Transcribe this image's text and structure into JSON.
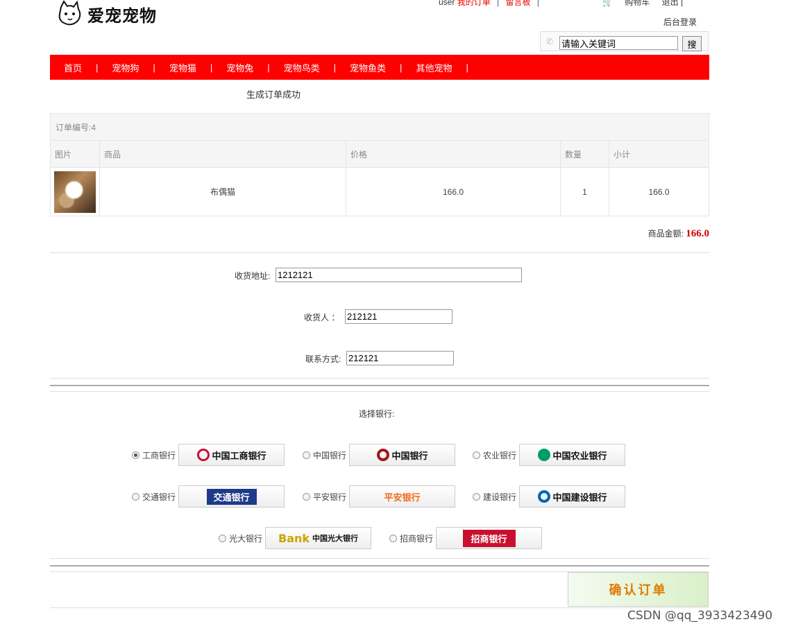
{
  "header": {
    "logo_text": "爱宠宠物",
    "user": "user",
    "my_orders": "我的订单",
    "message_board": "留言板",
    "cart": "购物车",
    "logout": "退出",
    "admin_login": "后台登录",
    "search_placeholder": "请输入关键词",
    "search_value": "请输入关键词",
    "search_button": "搜"
  },
  "nav": {
    "items": [
      "首页",
      "宠物狗",
      "宠物猫",
      "宠物兔",
      "宠物鸟类",
      "宠物鱼类",
      "其他宠物"
    ]
  },
  "order": {
    "success_msg": "生成订单成功",
    "order_no": "订单编号:4",
    "columns": [
      "图片",
      "商品",
      "价格",
      "数量",
      "小计"
    ],
    "rows": [
      {
        "image": "cat-photo",
        "name": "布偶猫",
        "price": "166.0",
        "qty": "1",
        "subtotal": "166.0"
      }
    ],
    "amount_label": "商品金额:",
    "amount_value": "166.0"
  },
  "form": {
    "address_label": "收货地址:",
    "address_value": "1212121",
    "receiver_label": "收货人 ：",
    "receiver_value": "212121",
    "contact_label": "联系方式:",
    "contact_value": "212121"
  },
  "bank": {
    "title": "选择银行:",
    "options": [
      {
        "name": "工商银行",
        "logo": "中国工商银行",
        "checked": true
      },
      {
        "name": "中国银行",
        "logo": "中国银行",
        "checked": false
      },
      {
        "name": "农业银行",
        "logo": "中国农业银行",
        "checked": false
      },
      {
        "name": "交通银行",
        "logo": "交通银行",
        "checked": false
      },
      {
        "name": "平安银行",
        "logo": "平安银行",
        "checked": false
      },
      {
        "name": "建设银行",
        "logo": "中国建设银行",
        "checked": false
      },
      {
        "name": "光大银行",
        "logo": "中国光大银行",
        "checked": false
      },
      {
        "name": "招商银行",
        "logo": "招商银行",
        "checked": false
      }
    ]
  },
  "confirm_button": "确认订单",
  "watermark": "CSDN @qq_3933423490",
  "colors": {
    "nav_red": "#ff0000",
    "amount_red": "#cc0000",
    "confirm_orange": "#e07a00"
  }
}
